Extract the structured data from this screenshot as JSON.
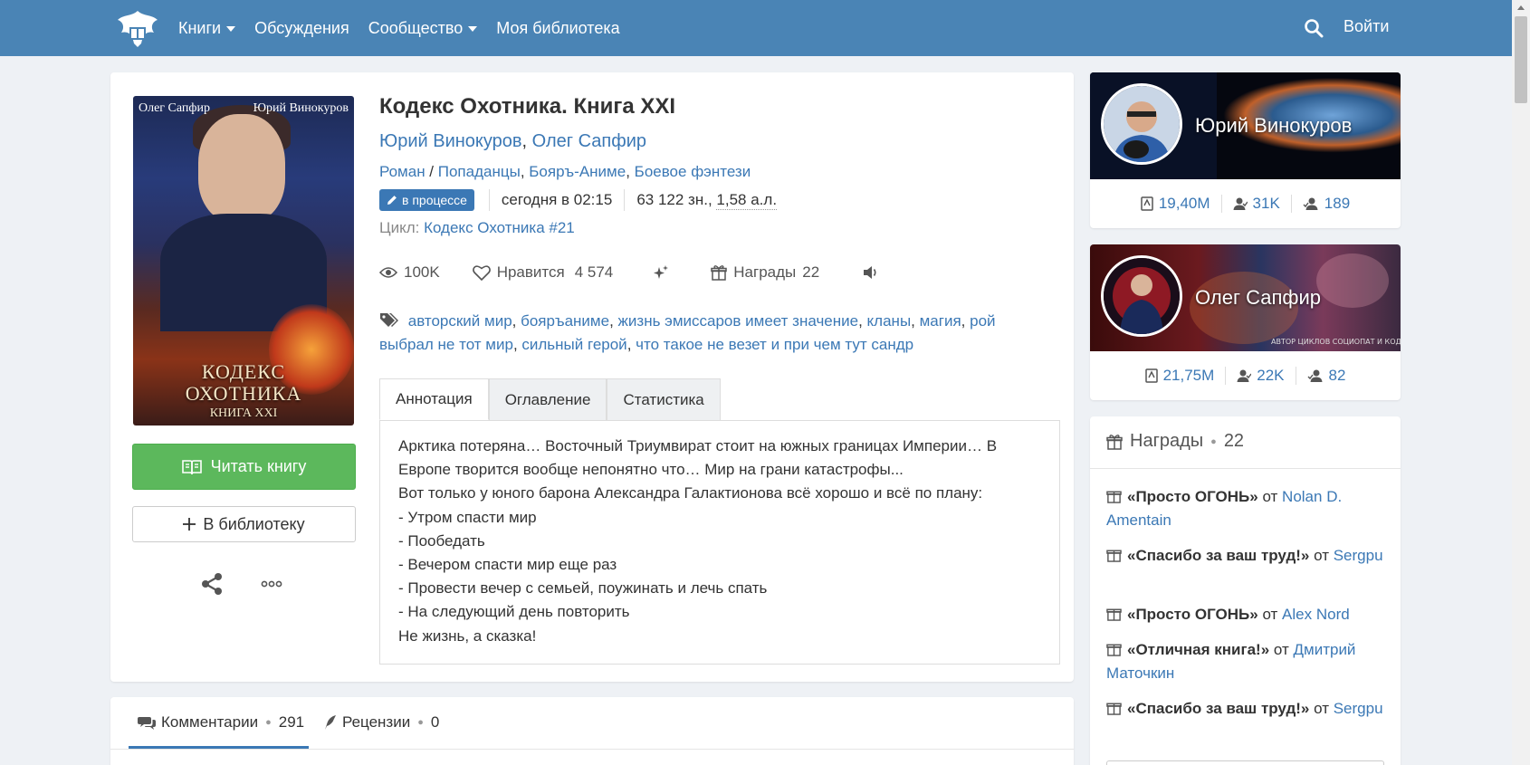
{
  "header": {
    "nav": [
      {
        "label": "Книги",
        "dropdown": true
      },
      {
        "label": "Обсуждения",
        "dropdown": false
      },
      {
        "label": "Сообщество",
        "dropdown": true
      },
      {
        "label": "Моя библиотека",
        "dropdown": false
      }
    ],
    "login_label": "Войти",
    "bar_color": "#4a84b5"
  },
  "book": {
    "cover": {
      "author_left": "Олег Сапфир",
      "author_right": "Юрий Винокуров",
      "title_line1": "КОДЕКС",
      "title_line2": "ОХОТНИКА",
      "title_line3": "КНИГА XXI"
    },
    "title": "Кодекс Охотника. Книга XXI",
    "authors": [
      "Юрий Винокуров",
      "Олег Сапфир"
    ],
    "authors_separator": ", ",
    "genre_main": "Роман",
    "genre_separator": " / ",
    "genres": [
      "Попаданцы",
      "Бояръ-Аниме",
      "Боевое фэнтези"
    ],
    "status": "в процессе",
    "updated": "сегодня в 02:15",
    "size_chars": "63 122 зн., ",
    "size_sheets": "1,58 а.л.",
    "cycle_label": "Цикл: ",
    "cycle_name": "Кодекс Охотника",
    "cycle_number": " #21",
    "views": "100K",
    "likes_label": "Нравится",
    "likes_count": "4 574",
    "awards_label": "Награды",
    "awards_count": "22",
    "tags": [
      "авторский мир",
      "бояръаниме",
      "жизнь эмиссаров имеет значение",
      "кланы",
      "магия",
      "рой выбрал не тот мир",
      "сильный герой",
      "что такое не везет и при чем тут сандр"
    ],
    "read_button": "Читать книгу",
    "library_button": "В библиотеку",
    "accent_color": "#3b78b5",
    "read_color": "#5cb85c"
  },
  "tabs": [
    "Аннотация",
    "Оглавление",
    "Статистика"
  ],
  "annotation": [
    "Арктика потеряна… Восточный Триумвират стоит на южных границах Империи… В Европе творится вообще непонятно что… Мир на грани катастрофы...",
    "Вот только у юного барона Александра Галактионова всё хорошо и всё по плану:",
    "- Утром спасти мир",
    "- Пообедать",
    "- Вечером спасти мир еще раз",
    "- Провести вечер с семьей, поужинать и лечь спать",
    "- На следующий день повторить",
    "Не жизнь, а сказка!"
  ],
  "comments": {
    "comments_label": "Комментарии",
    "comments_count": "291",
    "reviews_label": "Рецензии",
    "reviews_count": "0"
  },
  "author_cards": [
    {
      "name": "Юрий Винокуров",
      "stat_books": "19,40M",
      "stat_followers": "31K",
      "stat_friends": "189"
    },
    {
      "name": "Олег Сапфир",
      "stat_books": "21,75M",
      "stat_followers": "22K",
      "stat_friends": "82",
      "banner_text": "АВТОР ЦИКЛОВ СОЦИОПАТ И КОДЕ"
    }
  ],
  "awards": {
    "title": "Награды",
    "count": "22",
    "from_label": "от",
    "items": [
      {
        "name": "«Просто ОГОНЬ»",
        "from": "Nolan D. Amentain"
      },
      {
        "name": "«Спасибо за ваш труд!»",
        "from": "Sergpu"
      },
      {
        "name": "«Просто ОГОНЬ»",
        "from": "Alex Nord"
      },
      {
        "name": "«Отличная книга!»",
        "from": "Дмитрий Маточкин"
      },
      {
        "name": "«Спасибо за ваш труд!»",
        "from": "Sergpu"
      }
    ]
  }
}
